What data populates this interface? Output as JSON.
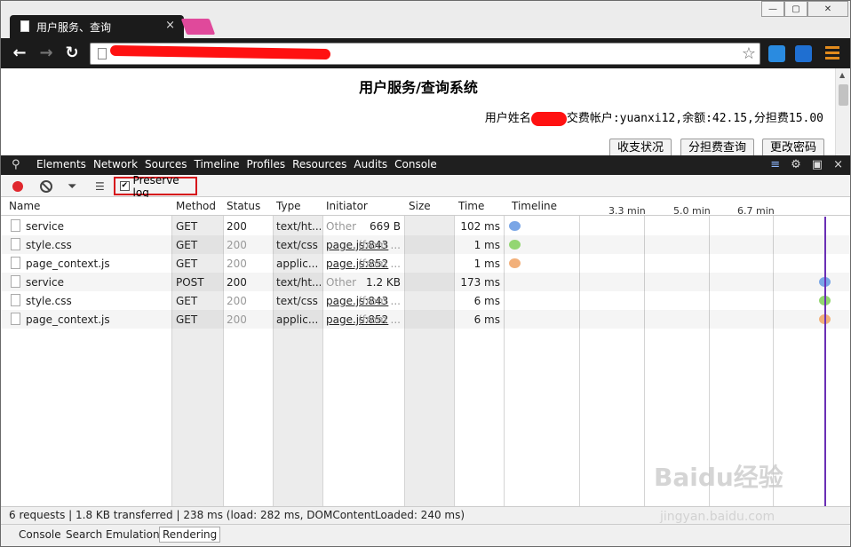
{
  "browser": {
    "tab_title": "用户服务、查询",
    "tab_close": "×",
    "window_buttons": [
      "—",
      "▢",
      "✕"
    ],
    "star": "☆"
  },
  "page": {
    "heading": "用户服务/查询系统",
    "user_prefix": "用户姓名",
    "user_suffix": "交费帐户:yuanxi12,余额:42.15,分担费15.00",
    "buttons": [
      "收支状况",
      "分担费查询",
      "更改密码"
    ]
  },
  "devtools": {
    "tabs": [
      "Elements",
      "Network",
      "Sources",
      "Timeline",
      "Profiles",
      "Resources",
      "Audits",
      "Console"
    ],
    "preserve_log": "Preserve log",
    "columns": [
      "Name",
      "Method",
      "Status",
      "Type",
      "Initiator",
      "Size",
      "Time",
      "Timeline"
    ],
    "timeline_ticks": [
      "3.3 min",
      "5.0 min",
      "6.7 min"
    ],
    "rows": [
      {
        "name": "service",
        "method": "GET",
        "status": "200",
        "type": "text/ht...",
        "initiator": "Other",
        "size": "669 B",
        "time": "102 ms",
        "color": "#7aa6e6"
      },
      {
        "name": "style.css",
        "method": "GET",
        "status": "200",
        "type": "text/css",
        "initiator": "page.js:843",
        "size": "(from ...",
        "time": "1 ms",
        "color": "#93d672"
      },
      {
        "name": "page_context.js",
        "method": "GET",
        "status": "200",
        "type": "applic...",
        "initiator": "page.js:852",
        "size": "(from ...",
        "time": "1 ms",
        "color": "#f2b07a"
      },
      {
        "name": "service",
        "method": "POST",
        "status": "200",
        "type": "text/ht...",
        "initiator": "Other",
        "size": "1.2 KB",
        "time": "173 ms",
        "color": "#7aa6e6"
      },
      {
        "name": "style.css",
        "method": "GET",
        "status": "200",
        "type": "text/css",
        "initiator": "page.js:843",
        "size": "(from ...",
        "time": "6 ms",
        "color": "#93d672"
      },
      {
        "name": "page_context.js",
        "method": "GET",
        "status": "200",
        "type": "applic...",
        "initiator": "page.js:852",
        "size": "(from ...",
        "time": "6 ms",
        "color": "#f2b07a"
      }
    ],
    "summary": "6 requests | 1.8 KB transferred | 238 ms (load: 282 ms, DOMContentLoaded: 240 ms)",
    "drawer_tabs": [
      "Console",
      "Search",
      "Emulation",
      "Rendering"
    ]
  },
  "watermark": {
    "line1": "Baidu经验",
    "line2": "jingyan.baidu.com"
  },
  "colors": {
    "accent": "#d6111b",
    "record": "#e0282e",
    "timeline_marker": "#6a2fb5"
  }
}
